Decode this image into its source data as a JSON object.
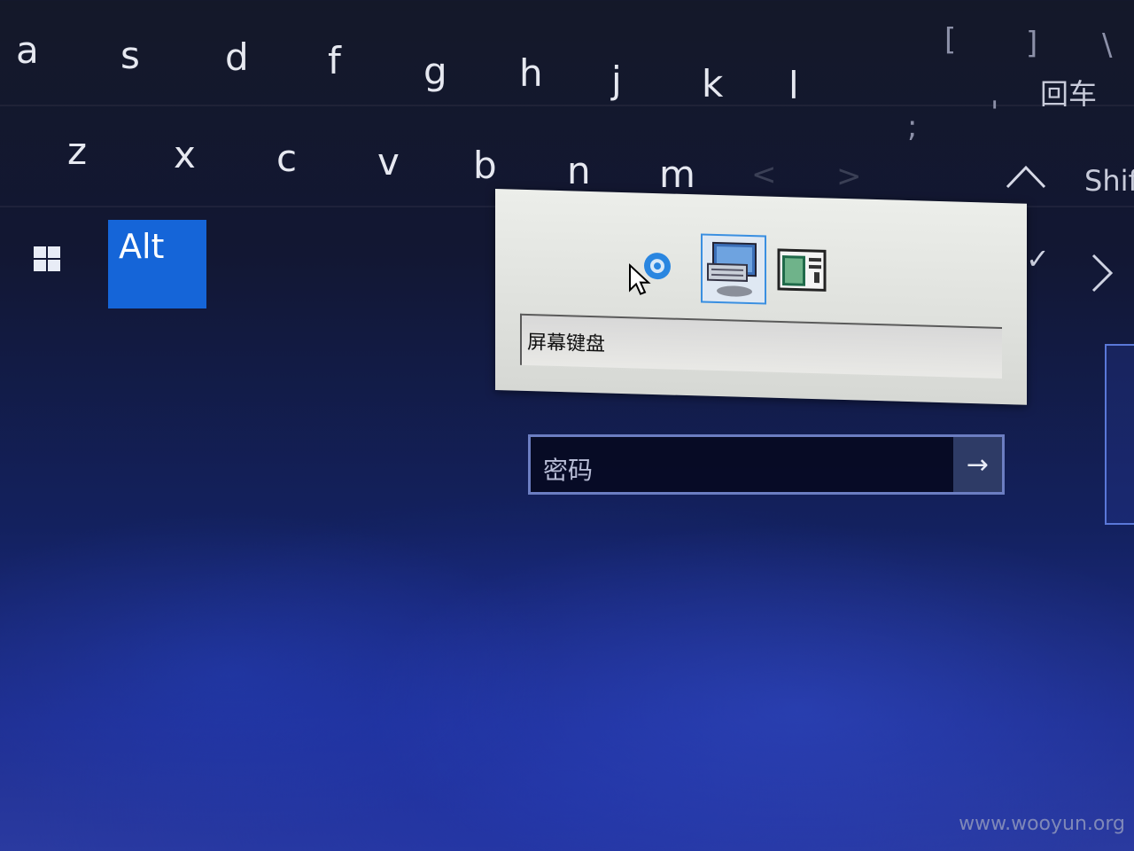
{
  "keyboard": {
    "row2": [
      "a",
      "s",
      "d",
      "f",
      "g",
      "h",
      "j",
      "k",
      "l"
    ],
    "row3": [
      "z",
      "x",
      "c",
      "v",
      "b",
      "n",
      "m"
    ],
    "brackets": [
      "[",
      "]",
      "\\"
    ],
    "punct": [
      ";",
      "'"
    ],
    "enter_label": "回车",
    "shift_label": "Shif",
    "up_arrow": "^",
    "alt_label": "Alt",
    "check": "✓",
    "chevron": ">",
    "lt": "<",
    "gt": ">"
  },
  "accessibility_popup": {
    "field_value": "屏幕键盘",
    "icons": [
      "ease-of-access-icon",
      "on-screen-keyboard-icon",
      "magnifier-icon"
    ]
  },
  "password_field": {
    "placeholder": "密码",
    "submit_arrow": "→"
  },
  "watermark": "www.wooyun.org",
  "colors": {
    "alt_accent": "#1565d8",
    "selection_border": "#3a8fe0"
  }
}
